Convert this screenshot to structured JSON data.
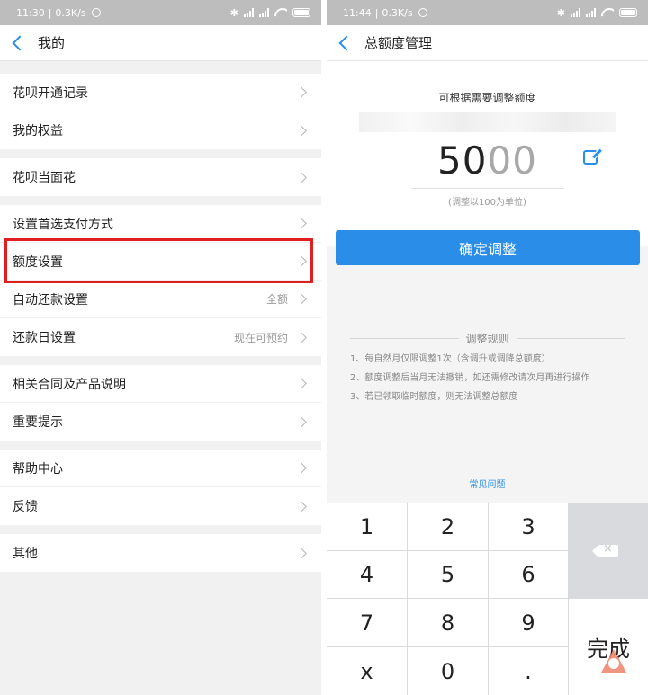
{
  "left": {
    "status": {
      "time": "11:30",
      "speed": "0.3K/s"
    },
    "title": "我的",
    "groups": [
      {
        "rows": [
          {
            "label": "花呗开通记录"
          },
          {
            "label": "我的权益"
          }
        ]
      },
      {
        "rows": [
          {
            "label": "花呗当面花"
          }
        ]
      },
      {
        "rows": [
          {
            "label": "设置首选支付方式"
          },
          {
            "label": "额度设置"
          },
          {
            "label": "自动还款设置",
            "value": "全额"
          },
          {
            "label": "还款日设置",
            "value": "现在可预约"
          }
        ]
      },
      {
        "rows": [
          {
            "label": "相关合同及产品说明"
          },
          {
            "label": "重要提示"
          }
        ]
      },
      {
        "rows": [
          {
            "label": "帮助中心"
          },
          {
            "label": "反馈"
          }
        ]
      },
      {
        "rows": [
          {
            "label": "其他"
          }
        ]
      }
    ],
    "highlight_color": "#e02020"
  },
  "right": {
    "status": {
      "time": "11:44",
      "speed": "0.3K/s"
    },
    "title": "总额度管理",
    "hint": "可根据需要调整额度",
    "amount_main": "50",
    "amount_faded": "00",
    "unit_note": "(调整以100为单位)",
    "confirm": "确定调整",
    "rules_title": "调整规则",
    "rules": [
      "1、每自然月仅限调整1次（含调升或调降总额度）",
      "2、额度调整后当月无法撤销，如还需修改请次月再进行操作",
      "3、若已领取临时额度，则无法调整总额度"
    ],
    "faq": "常见问题",
    "keys": [
      "1",
      "2",
      "3",
      "4",
      "5",
      "6",
      "7",
      "8",
      "9",
      "x",
      "0",
      "."
    ],
    "done": "完成",
    "accent": "#2a8ee8"
  }
}
